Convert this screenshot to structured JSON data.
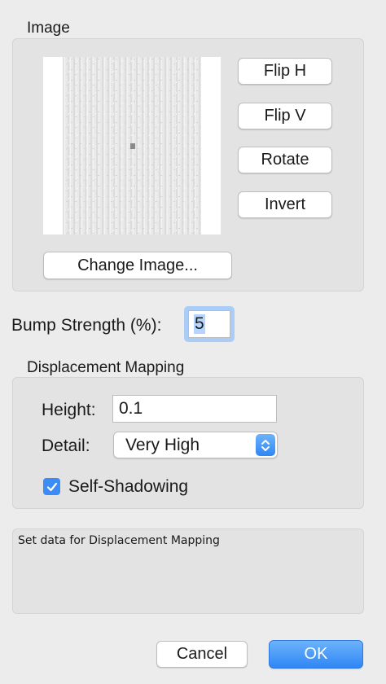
{
  "image_section": {
    "label": "Image",
    "flip_h": "Flip H",
    "flip_v": "Flip V",
    "rotate": "Rotate",
    "invert": "Invert",
    "change_image": "Change Image..."
  },
  "bump": {
    "label": "Bump Strength (%):",
    "value": "5"
  },
  "displacement": {
    "label": "Displacement Mapping",
    "height_label": "Height:",
    "height_value": "0.1",
    "detail_label": "Detail:",
    "detail_value": "Very High",
    "self_shadowing_label": "Self-Shadowing",
    "self_shadowing_checked": true
  },
  "info_text": "Set data for Displacement Mapping",
  "footer": {
    "cancel": "Cancel",
    "ok": "OK"
  },
  "colors": {
    "accent": "#3b8cf5",
    "ok_top": "#6cb3fa",
    "ok_bottom": "#2f86f5"
  }
}
